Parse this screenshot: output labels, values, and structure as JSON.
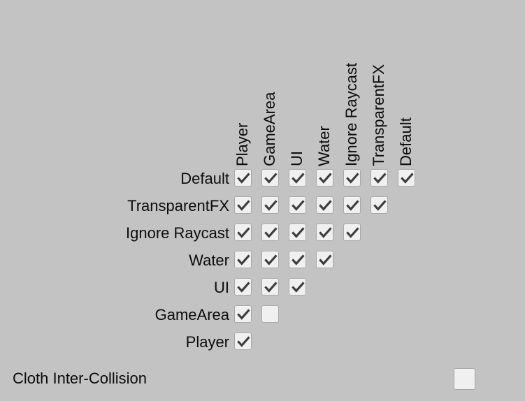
{
  "panel": {
    "name": "layer-collision-matrix"
  },
  "matrix": {
    "column_headers": [
      "Player",
      "GameArea",
      "UI",
      "Water",
      "Ignore Raycast",
      "TransparentFX",
      "Default"
    ],
    "row_labels": [
      "Default",
      "TransparentFX",
      "Ignore Raycast",
      "Water",
      "UI",
      "GameArea",
      "Player"
    ],
    "rows": [
      {
        "label": "Default",
        "cells": [
          true,
          true,
          true,
          true,
          true,
          true,
          true
        ]
      },
      {
        "label": "TransparentFX",
        "cells": [
          true,
          true,
          true,
          true,
          true,
          true
        ]
      },
      {
        "label": "Ignore Raycast",
        "cells": [
          true,
          true,
          true,
          true,
          true
        ]
      },
      {
        "label": "Water",
        "cells": [
          true,
          true,
          true,
          true
        ]
      },
      {
        "label": "UI",
        "cells": [
          true,
          true,
          true
        ]
      },
      {
        "label": "GameArea",
        "cells": [
          true,
          false
        ]
      },
      {
        "label": "Player",
        "cells": [
          true
        ]
      }
    ]
  },
  "cloth": {
    "label": "Cloth Inter-Collision",
    "checked": false
  },
  "colors": {
    "background": "#c3c3c3",
    "checkbox_fill": "#f0f0f0",
    "checkbox_border": "#a8a8a8",
    "checkmark": "#3c3c3c",
    "text": "#0b0b0b"
  },
  "icons": {
    "checkmark": "check-icon"
  }
}
